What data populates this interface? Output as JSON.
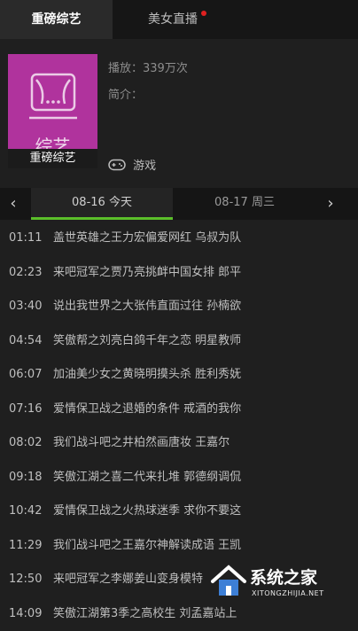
{
  "tabs": [
    {
      "label": "重磅综艺"
    },
    {
      "label": "美女直播"
    }
  ],
  "channel": {
    "thumb_word": "综艺",
    "thumb_label": "重磅综艺",
    "plays": "播放：339万次",
    "desc": "简介：",
    "game_label": "游戏"
  },
  "dates": [
    {
      "label": "08-16 今天"
    },
    {
      "label": "08-17 周三"
    }
  ],
  "schedule": [
    {
      "time": "01:11",
      "title": "盖世英雄之王力宏偏爱网红 乌叔为队"
    },
    {
      "time": "02:23",
      "title": "来吧冠军之贾乃亮挑衅中国女排 郎平"
    },
    {
      "time": "03:40",
      "title": "说出我世界之大张伟直面过往 孙楠欲"
    },
    {
      "time": "04:54",
      "title": "笑傲帮之刘亮白鸽千年之恋 明星教师"
    },
    {
      "time": "06:07",
      "title": "加油美少女之黄晓明摸头杀 胜利秀妩"
    },
    {
      "time": "07:16",
      "title": "爱情保卫战之退婚的条件 戒酒的我你"
    },
    {
      "time": "08:02",
      "title": "我们战斗吧之井柏然画唐妆 王嘉尔"
    },
    {
      "time": "09:18",
      "title": "笑傲江湖之喜二代来扎堆 郭德纲调侃"
    },
    {
      "time": "10:42",
      "title": "爱情保卫战之火热球迷季 求你不要这"
    },
    {
      "time": "11:29",
      "title": "我们战斗吧之王嘉尔神解读成语 王凯"
    },
    {
      "time": "12:50",
      "title": "来吧冠军之李娜姜山变身模特"
    },
    {
      "time": "14:09",
      "title": "笑傲江湖第3季之高校生 刘孟嘉站上"
    }
  ],
  "watermark": {
    "main": "系统之家",
    "sub": "XITONGZHIJIA.NET"
  }
}
